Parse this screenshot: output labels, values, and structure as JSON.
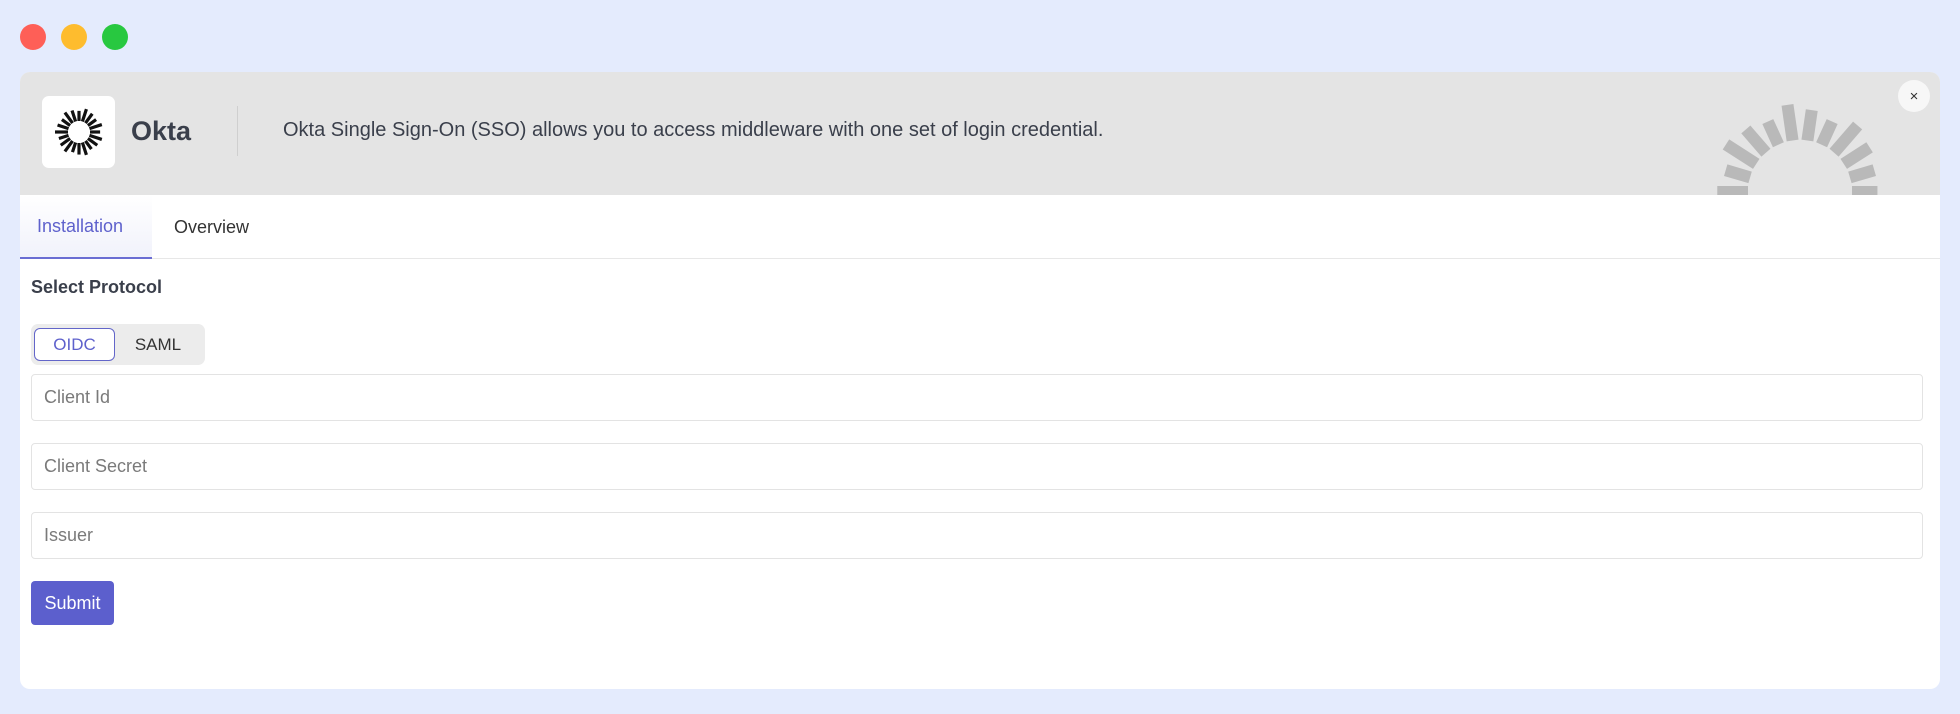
{
  "window": {
    "controls": [
      "close",
      "minimize",
      "maximize"
    ],
    "colors": {
      "close": "#fe5f57",
      "minimize": "#febc2e",
      "maximize": "#28c840"
    }
  },
  "header": {
    "logo_icon": "okta-sunburst-icon",
    "app_name": "Okta",
    "description": "Okta Single Sign-On (SSO) allows you to access middleware with one set of login credential.",
    "close_label": "×"
  },
  "tabs": [
    {
      "label": "Installation",
      "active": true
    },
    {
      "label": "Overview",
      "active": false
    }
  ],
  "form": {
    "section_title": "Select Protocol",
    "protocols": [
      {
        "label": "OIDC",
        "selected": true
      },
      {
        "label": "SAML",
        "selected": false
      }
    ],
    "fields": [
      {
        "placeholder": "Client Id",
        "value": ""
      },
      {
        "placeholder": "Client Secret",
        "value": ""
      },
      {
        "placeholder": "Issuer",
        "value": ""
      }
    ],
    "submit_label": "Submit"
  },
  "colors": {
    "accent": "#5c5fcd",
    "header_bg": "#e4e4e4",
    "page_bg": "#e4ebfd"
  }
}
